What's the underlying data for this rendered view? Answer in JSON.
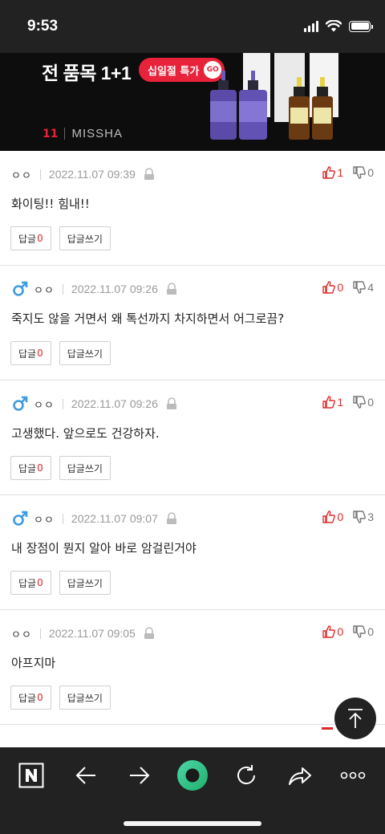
{
  "status_bar": {
    "time": "9:53"
  },
  "ad": {
    "headline": "전 품목 1+1",
    "badge_text": "십일절 특가",
    "badge_go": "GO",
    "logo_11st": "11",
    "logo_brand": "MISSHA"
  },
  "comments": [
    {
      "user": "ㅇㅇ",
      "gender": "none",
      "date": "2022.11.07 09:39",
      "up": "1",
      "down": "0",
      "text": "화이팅!! 힘내!!",
      "reply_label": "답글",
      "reply_count": "0",
      "write_label": "답글쓰기"
    },
    {
      "user": "ㅇㅇ",
      "gender": "male",
      "date": "2022.11.07 09:26",
      "up": "0",
      "down": "4",
      "text": "죽지도 않을 거면서 왜 톡선까지 차지하면서 어그로끔?",
      "reply_label": "답글",
      "reply_count": "0",
      "write_label": "답글쓰기"
    },
    {
      "user": "ㅇㅇ",
      "gender": "male",
      "date": "2022.11.07 09:26",
      "up": "1",
      "down": "0",
      "text": "고생했다. 앞으로도 건강하자.",
      "reply_label": "답글",
      "reply_count": "0",
      "write_label": "답글쓰기"
    },
    {
      "user": "ㅇㅇ",
      "gender": "male",
      "date": "2022.11.07 09:07",
      "up": "0",
      "down": "3",
      "text": "내 장점이 뭔지 알아 바로 암걸린거야",
      "reply_label": "답글",
      "reply_count": "0",
      "write_label": "답글쓰기"
    },
    {
      "user": "ㅇㅇ",
      "gender": "none",
      "date": "2022.11.07 09:05",
      "up": "0",
      "down": "0",
      "text": "아프지마",
      "reply_label": "답글",
      "reply_count": "0",
      "write_label": "답글쓰기"
    }
  ],
  "colors": {
    "accent_red": "#e02a2a",
    "male_blue": "#3d9be0",
    "toolbar_bg": "#222222",
    "go_green": "#35c48a"
  },
  "toolbar": {
    "icons": [
      "naver-icon",
      "back-arrow-icon",
      "forward-arrow-icon",
      "green-dot-icon",
      "refresh-icon",
      "share-icon",
      "more-icon"
    ]
  }
}
